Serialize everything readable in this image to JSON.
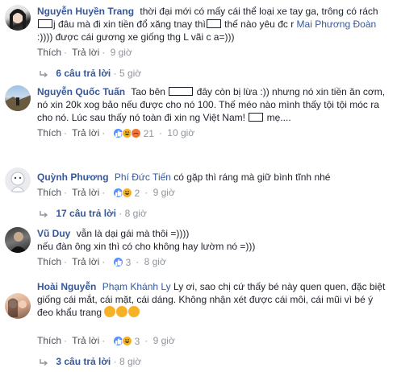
{
  "comments": [
    {
      "author": "Nguyễn Huyền Trang",
      "text_1": "thời đại mới có mấy cái thể loại xe tay ga, trông có rách",
      "text_2": "j đâu mà đi xin tiền đổ xăng tnay thì",
      "text_3": "thế nào yêu đc r",
      "mention": "Mai Phương Đoàn",
      "text_4": ":)))) được cái gương xe giống thg L vãi c a=)))",
      "actions": {
        "like": "Thích",
        "reply": "Trả lời",
        "time": "9 giờ"
      },
      "replies": {
        "count": "6 câu trả lời",
        "time": "5 giờ"
      }
    },
    {
      "author": "Nguyễn Quốc Tuấn",
      "text_1": "Tao bên",
      "text_2": "đây còn bị lừa :)) nhưng nó xin tiền ăn cơm, nó xin 20k xog bảo nếu được cho nó 100. Thế méo nào mình thấy tội tội móc ra cho nó. Lúc sau thấy nó toàn đi xin ng Việt Nam!",
      "text_3": "mẹ....",
      "actions": {
        "like": "Thích",
        "reply": "Trả lời",
        "reactions": "21",
        "time": "10 giờ"
      }
    },
    {
      "author": "Quỳnh Phương",
      "mention": "Phí Đức Tiến",
      "text_1": "có gặp thì ráng mà giữ bình tĩnh nhé",
      "actions": {
        "like": "Thích",
        "reply": "Trả lời",
        "reactions": "2",
        "time": "9 giờ"
      },
      "replies": {
        "count": "17 câu trả lời",
        "time": "8 giờ"
      }
    },
    {
      "author": "Vũ Duy",
      "text_1": "vẫn là dại gái mà thôi =))))",
      "text_2": "nếu đàn ông xin thì có cho không hay lườm nó =)))",
      "actions": {
        "like": "Thích",
        "reply": "Trả lời",
        "reactions": "3",
        "time": "8 giờ"
      }
    },
    {
      "author": "Hoài Nguyễn",
      "mention": "Phạm Khánh Ly",
      "text_1": "Ly ơi, sao chị cứ thấy bé này quen quen, đặc biệt giống cái mắt, cái mặt, cái dáng. Không nhận xét được cái môi, cái mũi vì bé ý đeo khẩu trang",
      "actions": {
        "like": "Thích",
        "reply": "Trả lời",
        "reactions": "3",
        "time": "9 giờ"
      },
      "replies": {
        "count": "3 câu trả lời",
        "time": "8 giờ"
      }
    }
  ],
  "colors": {
    "link": "#365899",
    "meta": "#90949c",
    "like": "#5890ff",
    "haha": "#f7b125",
    "angry": "#f0743a"
  }
}
